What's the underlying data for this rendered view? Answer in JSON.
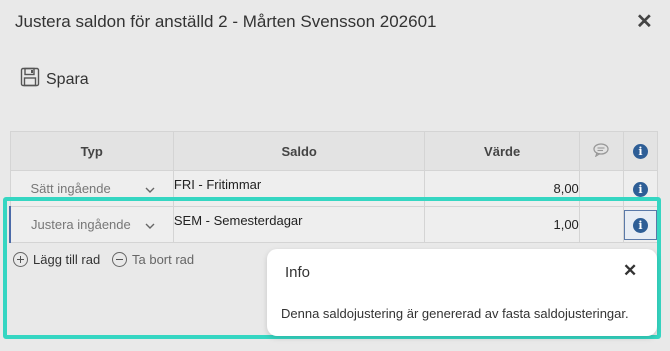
{
  "dialog": {
    "title": "Justera saldon för anställd 2 - Mårten Svensson 202601",
    "close_glyph": "✕"
  },
  "toolbar": {
    "save_label": "Spara"
  },
  "table": {
    "headers": {
      "typ": "Typ",
      "saldo": "Saldo",
      "varde": "Värde"
    },
    "rows": [
      {
        "typ": "Sätt ingående",
        "saldo": "FRI - Fritimmar",
        "varde": "8,00"
      },
      {
        "typ": "Justera ingående",
        "saldo": "SEM - Semesterdagar",
        "varde": "1,00"
      }
    ]
  },
  "actions": {
    "add_row": "Lägg till rad",
    "remove_row": "Ta bort rad"
  },
  "popup": {
    "title": "Info",
    "close_glyph": "✕",
    "body": "Denna saldojustering är genererad av fasta saldojusteringar."
  },
  "colors": {
    "highlight": "#35d6c2",
    "info_icon": "#2e5e96"
  },
  "icons": [
    "save-icon",
    "close-icon",
    "comment-icon",
    "info-icon",
    "chevron-down-icon",
    "add-circle-icon",
    "remove-circle-icon"
  ]
}
